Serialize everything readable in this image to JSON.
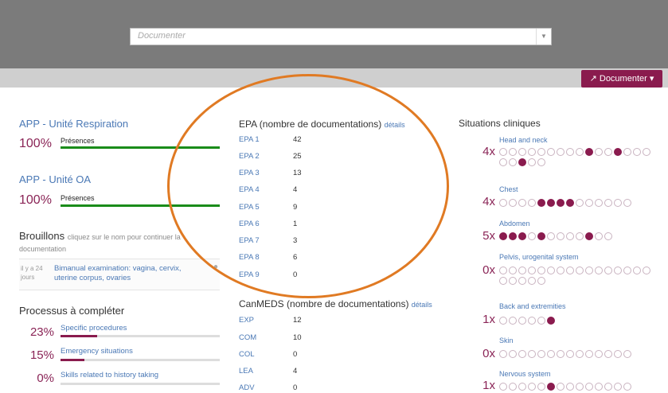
{
  "header": {
    "search_placeholder": "Documenter",
    "documenter_button": "Documenter",
    "button_icon": "external-link-icon"
  },
  "apps": [
    {
      "title": "APP - Unité Respiration",
      "percent": "100%",
      "presence_label": "Présences"
    },
    {
      "title": "APP - Unité OA",
      "percent": "100%",
      "presence_label": "Présences"
    }
  ],
  "drafts": {
    "title": "Brouillons",
    "hint": "cliquez sur le nom pour continuer la documentation",
    "item": {
      "date": "il y a 24 jours",
      "text": "Bimanual examination: vagina, cervix, uterine corpus, ovaries"
    }
  },
  "processes": {
    "title": "Processus à compléter",
    "items": [
      {
        "percent": "23%",
        "label": "Specific procedures",
        "fill": 0.23
      },
      {
        "percent": "15%",
        "label": "Emergency situations",
        "fill": 0.15
      },
      {
        "percent": "0%",
        "label": "Skills related to history taking",
        "fill": 0
      }
    ]
  },
  "epa": {
    "title": "EPA (nombre de documentations)",
    "details": "détails",
    "rows": [
      {
        "code": "EPA 1",
        "value": "42"
      },
      {
        "code": "EPA 2",
        "value": "25"
      },
      {
        "code": "EPA 3",
        "value": "13"
      },
      {
        "code": "EPA 4",
        "value": "4"
      },
      {
        "code": "EPA 5",
        "value": "9"
      },
      {
        "code": "EPA 6",
        "value": "1"
      },
      {
        "code": "EPA 7",
        "value": "3"
      },
      {
        "code": "EPA 8",
        "value": "6"
      },
      {
        "code": "EPA 9",
        "value": "0"
      }
    ]
  },
  "canmeds": {
    "title": "CanMEDS (nombre de documentations)",
    "details": "détails",
    "rows": [
      {
        "code": "EXP",
        "value": "12"
      },
      {
        "code": "COM",
        "value": "10"
      },
      {
        "code": "COL",
        "value": "0"
      },
      {
        "code": "LEA",
        "value": "4"
      },
      {
        "code": "ADV",
        "value": "0"
      }
    ]
  },
  "situations": {
    "title": "Situations cliniques",
    "items": [
      {
        "label": "Head and neck",
        "count": "4x",
        "filled": [
          9,
          12,
          18
        ]
      },
      {
        "label": "Chest",
        "count": "4x",
        "filled": [
          4,
          5,
          6,
          7
        ]
      },
      {
        "label": "Abdomen",
        "count": "5x",
        "filled": [
          0,
          1,
          2,
          4,
          9
        ]
      },
      {
        "label": "Pelvis, urogenital system",
        "count": "0x",
        "filled": []
      },
      {
        "label": "Back and extremities",
        "count": "1x",
        "filled": [
          5
        ]
      },
      {
        "label": "Skin",
        "count": "0x",
        "filled": []
      },
      {
        "label": "Nervous system",
        "count": "1x",
        "filled": [
          5
        ]
      }
    ]
  },
  "colors": {
    "accent": "#8a1b4e",
    "link": "#4a78b5",
    "presence_bar": "#1a8c1a",
    "annotation_ring": "#e07a23"
  }
}
